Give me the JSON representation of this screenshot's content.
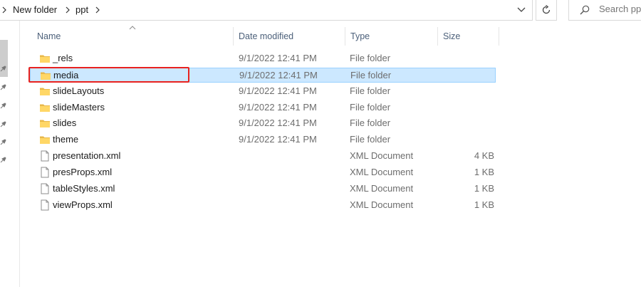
{
  "breadcrumb": {
    "items": [
      "New folder",
      "ppt"
    ]
  },
  "search": {
    "placeholder": "Search ppt"
  },
  "columns": {
    "name": "Name",
    "date": "Date modified",
    "type": "Type",
    "size": "Size"
  },
  "files": [
    {
      "name": "_rels",
      "date": "9/1/2022 12:41 PM",
      "type": "File folder",
      "size": "",
      "icon": "folder-icon"
    },
    {
      "name": "media",
      "date": "9/1/2022 12:41 PM",
      "type": "File folder",
      "size": "",
      "icon": "folder-icon",
      "selected": true
    },
    {
      "name": "slideLayouts",
      "date": "9/1/2022 12:41 PM",
      "type": "File folder",
      "size": "",
      "icon": "folder-icon"
    },
    {
      "name": "slideMasters",
      "date": "9/1/2022 12:41 PM",
      "type": "File folder",
      "size": "",
      "icon": "folder-icon"
    },
    {
      "name": "slides",
      "date": "9/1/2022 12:41 PM",
      "type": "File folder",
      "size": "",
      "icon": "folder-icon"
    },
    {
      "name": "theme",
      "date": "9/1/2022 12:41 PM",
      "type": "File folder",
      "size": "",
      "icon": "folder-icon"
    },
    {
      "name": "presentation.xml",
      "date": "",
      "type": "XML Document",
      "size": "4 KB",
      "icon": "document-icon"
    },
    {
      "name": "presProps.xml",
      "date": "",
      "type": "XML Document",
      "size": "1 KB",
      "icon": "document-icon"
    },
    {
      "name": "tableStyles.xml",
      "date": "",
      "type": "XML Document",
      "size": "1 KB",
      "icon": "document-icon"
    },
    {
      "name": "viewProps.xml",
      "date": "",
      "type": "XML Document",
      "size": "1 KB",
      "icon": "document-icon"
    }
  ],
  "colors": {
    "selection_fill": "#cce8ff",
    "selection_border": "#99d1ff",
    "annotation_red": "#e8221f",
    "folder_yellow": "#ffd766"
  }
}
